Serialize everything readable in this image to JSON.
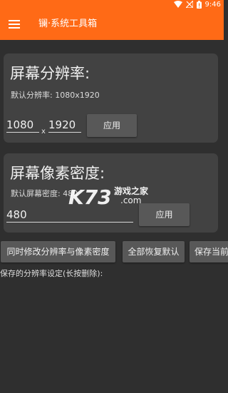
{
  "status_bar": {
    "time": "9:46",
    "battery_glyph": "!"
  },
  "app_bar": {
    "title": "镧·系统工具箱"
  },
  "resolution_card": {
    "title": "屏幕分辨率:",
    "default_text": "默认分辨率: 1080x1920",
    "width_value": "1080",
    "separator": "x",
    "height_value": "1920",
    "apply_label": "应用"
  },
  "density_card": {
    "title": "屏幕像素密度:",
    "default_text": "默认屏幕密度: 480",
    "density_value": "480",
    "apply_label": "应用"
  },
  "actions": {
    "both_label": "同时修改分辨率与像素密度",
    "restore_label": "全部恢复默认",
    "save_label": "保存当前"
  },
  "saved_section": {
    "label": "保存的分辨率设定(长按删除):"
  },
  "watermark": {
    "logo_text": "K73",
    "site_name": "游戏之家",
    "domain": ".com"
  },
  "colors": {
    "accent": "#ff6a16",
    "background": "#2f2f2f",
    "card": "#424242",
    "button": "#585858"
  }
}
